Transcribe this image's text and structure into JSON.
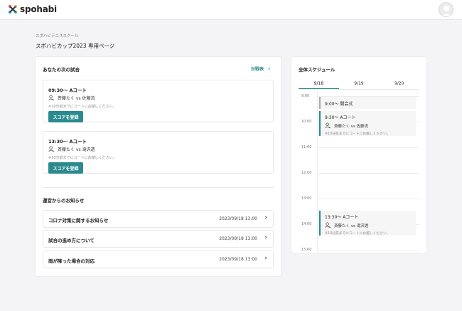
{
  "header": {
    "logo_text": "spohabi",
    "avatar_icon": "user-avatar-icon"
  },
  "breadcrumb": "スポハビテニススクール",
  "page_title": "スポハビカップ2023 専用ページ",
  "next_matches": {
    "title": "あなたの次の試合",
    "link_label": "対戦表",
    "matches": [
      {
        "time": "09:30〜 Aコート",
        "players": "斉藤たく vs 佐藤流",
        "note": "※10分前までにコートにお越しください。",
        "button": "スコアを登録"
      },
      {
        "time": "13:30〜 Aコート",
        "players": "斉藤たく vs 滝沢透",
        "note": "※10分前までにコートにお越しください。",
        "button": "スコアを登録"
      }
    ]
  },
  "notices": {
    "title": "運営からのお知らせ",
    "items": [
      {
        "title": "コロナ対策に関するお知らせ",
        "date": "2023/09/18 13:00"
      },
      {
        "title": "試合の進め方について",
        "date": "2023/09/18 13:00"
      },
      {
        "title": "雨が降った場合の対応",
        "date": "2023/09/18 13:00"
      }
    ]
  },
  "schedule": {
    "title": "全体スケジュール",
    "tabs": [
      "9/18",
      "9/19",
      "9/20"
    ],
    "active_tab": "9/18",
    "hours": [
      "9:00",
      "10:00",
      "11:00",
      "12:00",
      "13:00",
      "14:00",
      "15:00"
    ],
    "events": [
      {
        "time": "9:00〜 開会式"
      },
      {
        "time": "9:30〜 Aコート",
        "players": "斉藤たく vs 佐藤流",
        "note": "※10分前までにコートにお越しください。"
      },
      {
        "time": "13:30〜 Aコート",
        "players": "斉藤たく vs 滝沢透",
        "note": "※10分前までにコートにお越しください。"
      }
    ]
  },
  "colors": {
    "accent": "#2a8a8e"
  }
}
